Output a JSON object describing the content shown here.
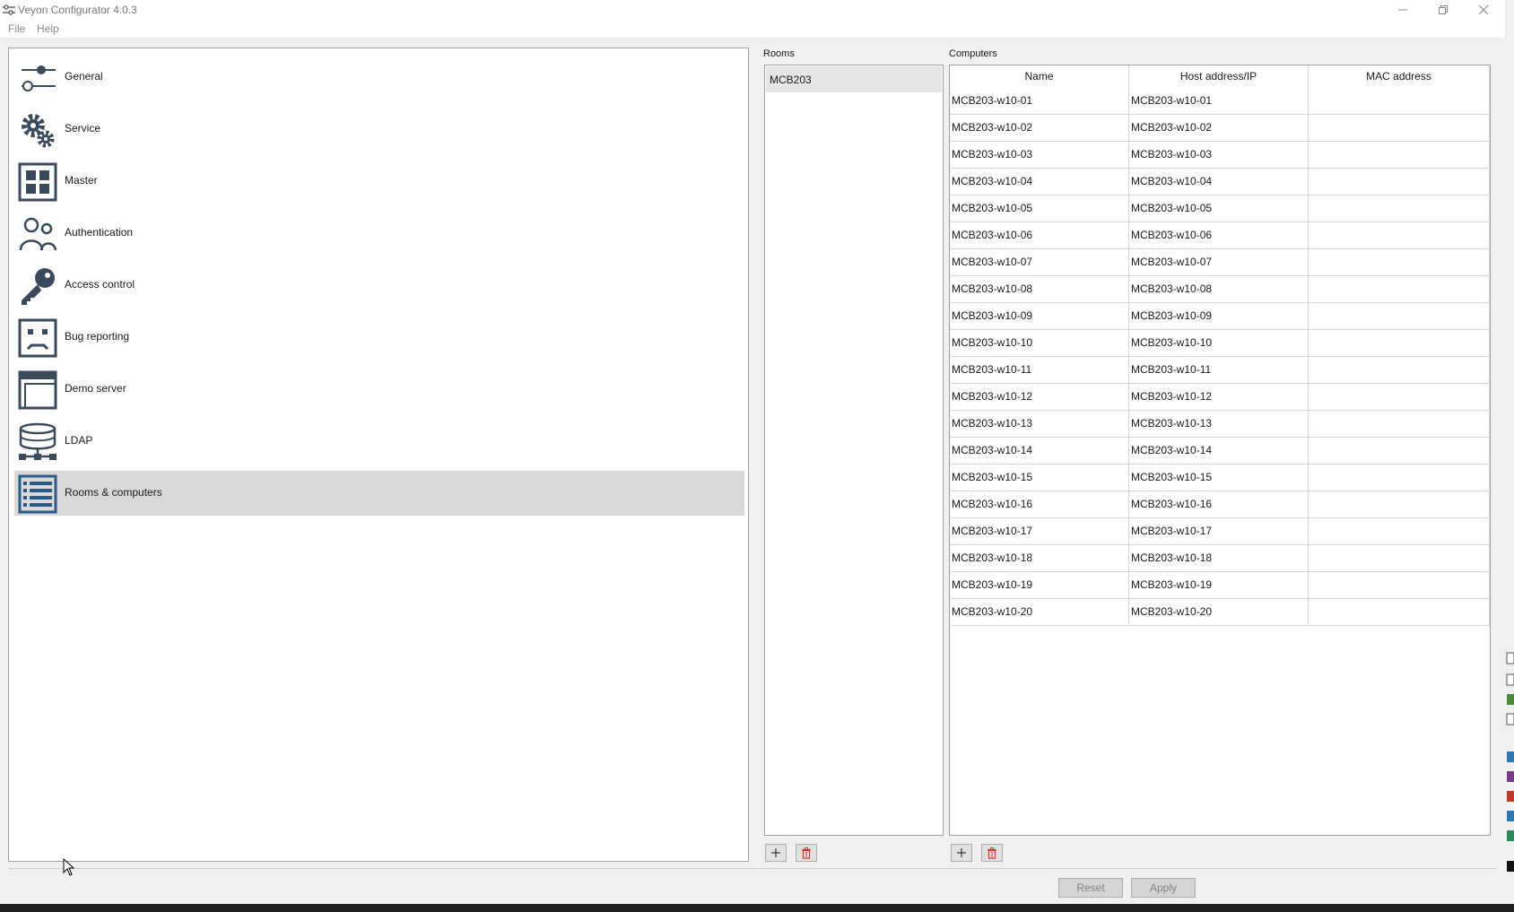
{
  "window": {
    "title": "Veyon Configurator 4.0.3",
    "controls": [
      "minimize-icon",
      "restore-icon",
      "close-icon"
    ]
  },
  "menu": {
    "items": [
      "File",
      "Help"
    ]
  },
  "sidebar": {
    "items": [
      {
        "label": "General",
        "icon": "sliders-icon"
      },
      {
        "label": "Service",
        "icon": "gears-icon"
      },
      {
        "label": "Master",
        "icon": "grid-icon"
      },
      {
        "label": "Authentication",
        "icon": "users-icon"
      },
      {
        "label": "Access control",
        "icon": "key-icon"
      },
      {
        "label": "Bug reporting",
        "icon": "sad-face-icon"
      },
      {
        "label": "Demo server",
        "icon": "window-icon"
      },
      {
        "label": "LDAP",
        "icon": "database-icon"
      },
      {
        "label": "Rooms & computers",
        "icon": "list-icon",
        "selected": true
      }
    ]
  },
  "rooms": {
    "label": "Rooms",
    "items": [
      "MCB203"
    ],
    "selected": "MCB203"
  },
  "computers": {
    "label": "Computers",
    "columns": [
      "Name",
      "Host address/IP",
      "MAC address"
    ],
    "rows": [
      [
        "MCB203-w10-01",
        "MCB203-w10-01",
        ""
      ],
      [
        "MCB203-w10-02",
        "MCB203-w10-02",
        ""
      ],
      [
        "MCB203-w10-03",
        "MCB203-w10-03",
        ""
      ],
      [
        "MCB203-w10-04",
        "MCB203-w10-04",
        ""
      ],
      [
        "MCB203-w10-05",
        "MCB203-w10-05",
        ""
      ],
      [
        "MCB203-w10-06",
        "MCB203-w10-06",
        ""
      ],
      [
        "MCB203-w10-07",
        "MCB203-w10-07",
        ""
      ],
      [
        "MCB203-w10-08",
        "MCB203-w10-08",
        ""
      ],
      [
        "MCB203-w10-09",
        "MCB203-w10-09",
        ""
      ],
      [
        "MCB203-w10-10",
        "MCB203-w10-10",
        ""
      ],
      [
        "MCB203-w10-11",
        "MCB203-w10-11",
        ""
      ],
      [
        "MCB203-w10-12",
        "MCB203-w10-12",
        ""
      ],
      [
        "MCB203-w10-13",
        "MCB203-w10-13",
        ""
      ],
      [
        "MCB203-w10-14",
        "MCB203-w10-14",
        ""
      ],
      [
        "MCB203-w10-15",
        "MCB203-w10-15",
        ""
      ],
      [
        "MCB203-w10-16",
        "MCB203-w10-16",
        ""
      ],
      [
        "MCB203-w10-17",
        "MCB203-w10-17",
        ""
      ],
      [
        "MCB203-w10-18",
        "MCB203-w10-18",
        ""
      ],
      [
        "MCB203-w10-19",
        "MCB203-w10-19",
        ""
      ],
      [
        "MCB203-w10-20",
        "MCB203-w10-20",
        ""
      ]
    ]
  },
  "toolbar": {
    "add_icon": "plus-icon",
    "remove_icon": "trash-icon"
  },
  "buttons": {
    "reset": "Reset",
    "apply": "Apply"
  },
  "colors": {
    "icon": "#3a4a5a",
    "selected_bg": "#d9d9d9",
    "trash": "#d0342c",
    "accent_list": "#2b5a8a"
  }
}
